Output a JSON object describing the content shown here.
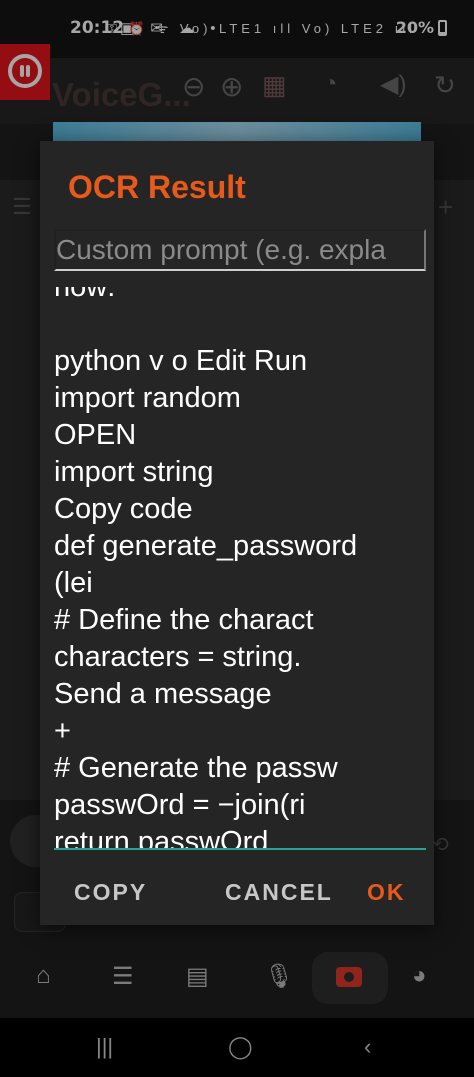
{
  "status_bar": {
    "time": "20:12",
    "battery": "20%",
    "left_icons": "▣ ✉ ☁ •",
    "right_icons": "⚿ ⏰ ᯤ Vo) LTE1 ıll Vo) LTE2 ıll"
  },
  "app": {
    "title": "VoiceG...",
    "icons": [
      "zoom-out-icon",
      "zoom-in-icon",
      "us-flag-icon",
      "speedometer-icon",
      "volume-icon",
      "refresh-icon"
    ]
  },
  "dialog": {
    "title": "OCR Result",
    "prompt_placeholder": "Custom prompt (e.g. expla",
    "ocr_lines": [
      "now:",
      "",
      "python v o Edit Run",
      "import random",
      "OPEN",
      "import string",
      "Copy code",
      "def generate_password",
      "(lei",
      "# Define the charact",
      "characters = string.",
      "Send a message",
      "+",
      "# Generate the passw",
      "passwOrd = −join(ri",
      "return passwOrd"
    ],
    "buttons": {
      "copy": "COPY",
      "cancel": "CANCEL",
      "ok": "OK"
    }
  },
  "bottom_nav": [
    "home-icon",
    "menu-icon",
    "chat-icon",
    "mic-icon",
    "camera-icon",
    "palette-icon"
  ],
  "system_nav": [
    "recents-icon",
    "home-circle-icon",
    "back-icon"
  ],
  "colors": {
    "accent": "#e8591c",
    "focus_line": "#2aa198",
    "dialog_bg": "#252525",
    "brand_red": "#e3141c"
  }
}
